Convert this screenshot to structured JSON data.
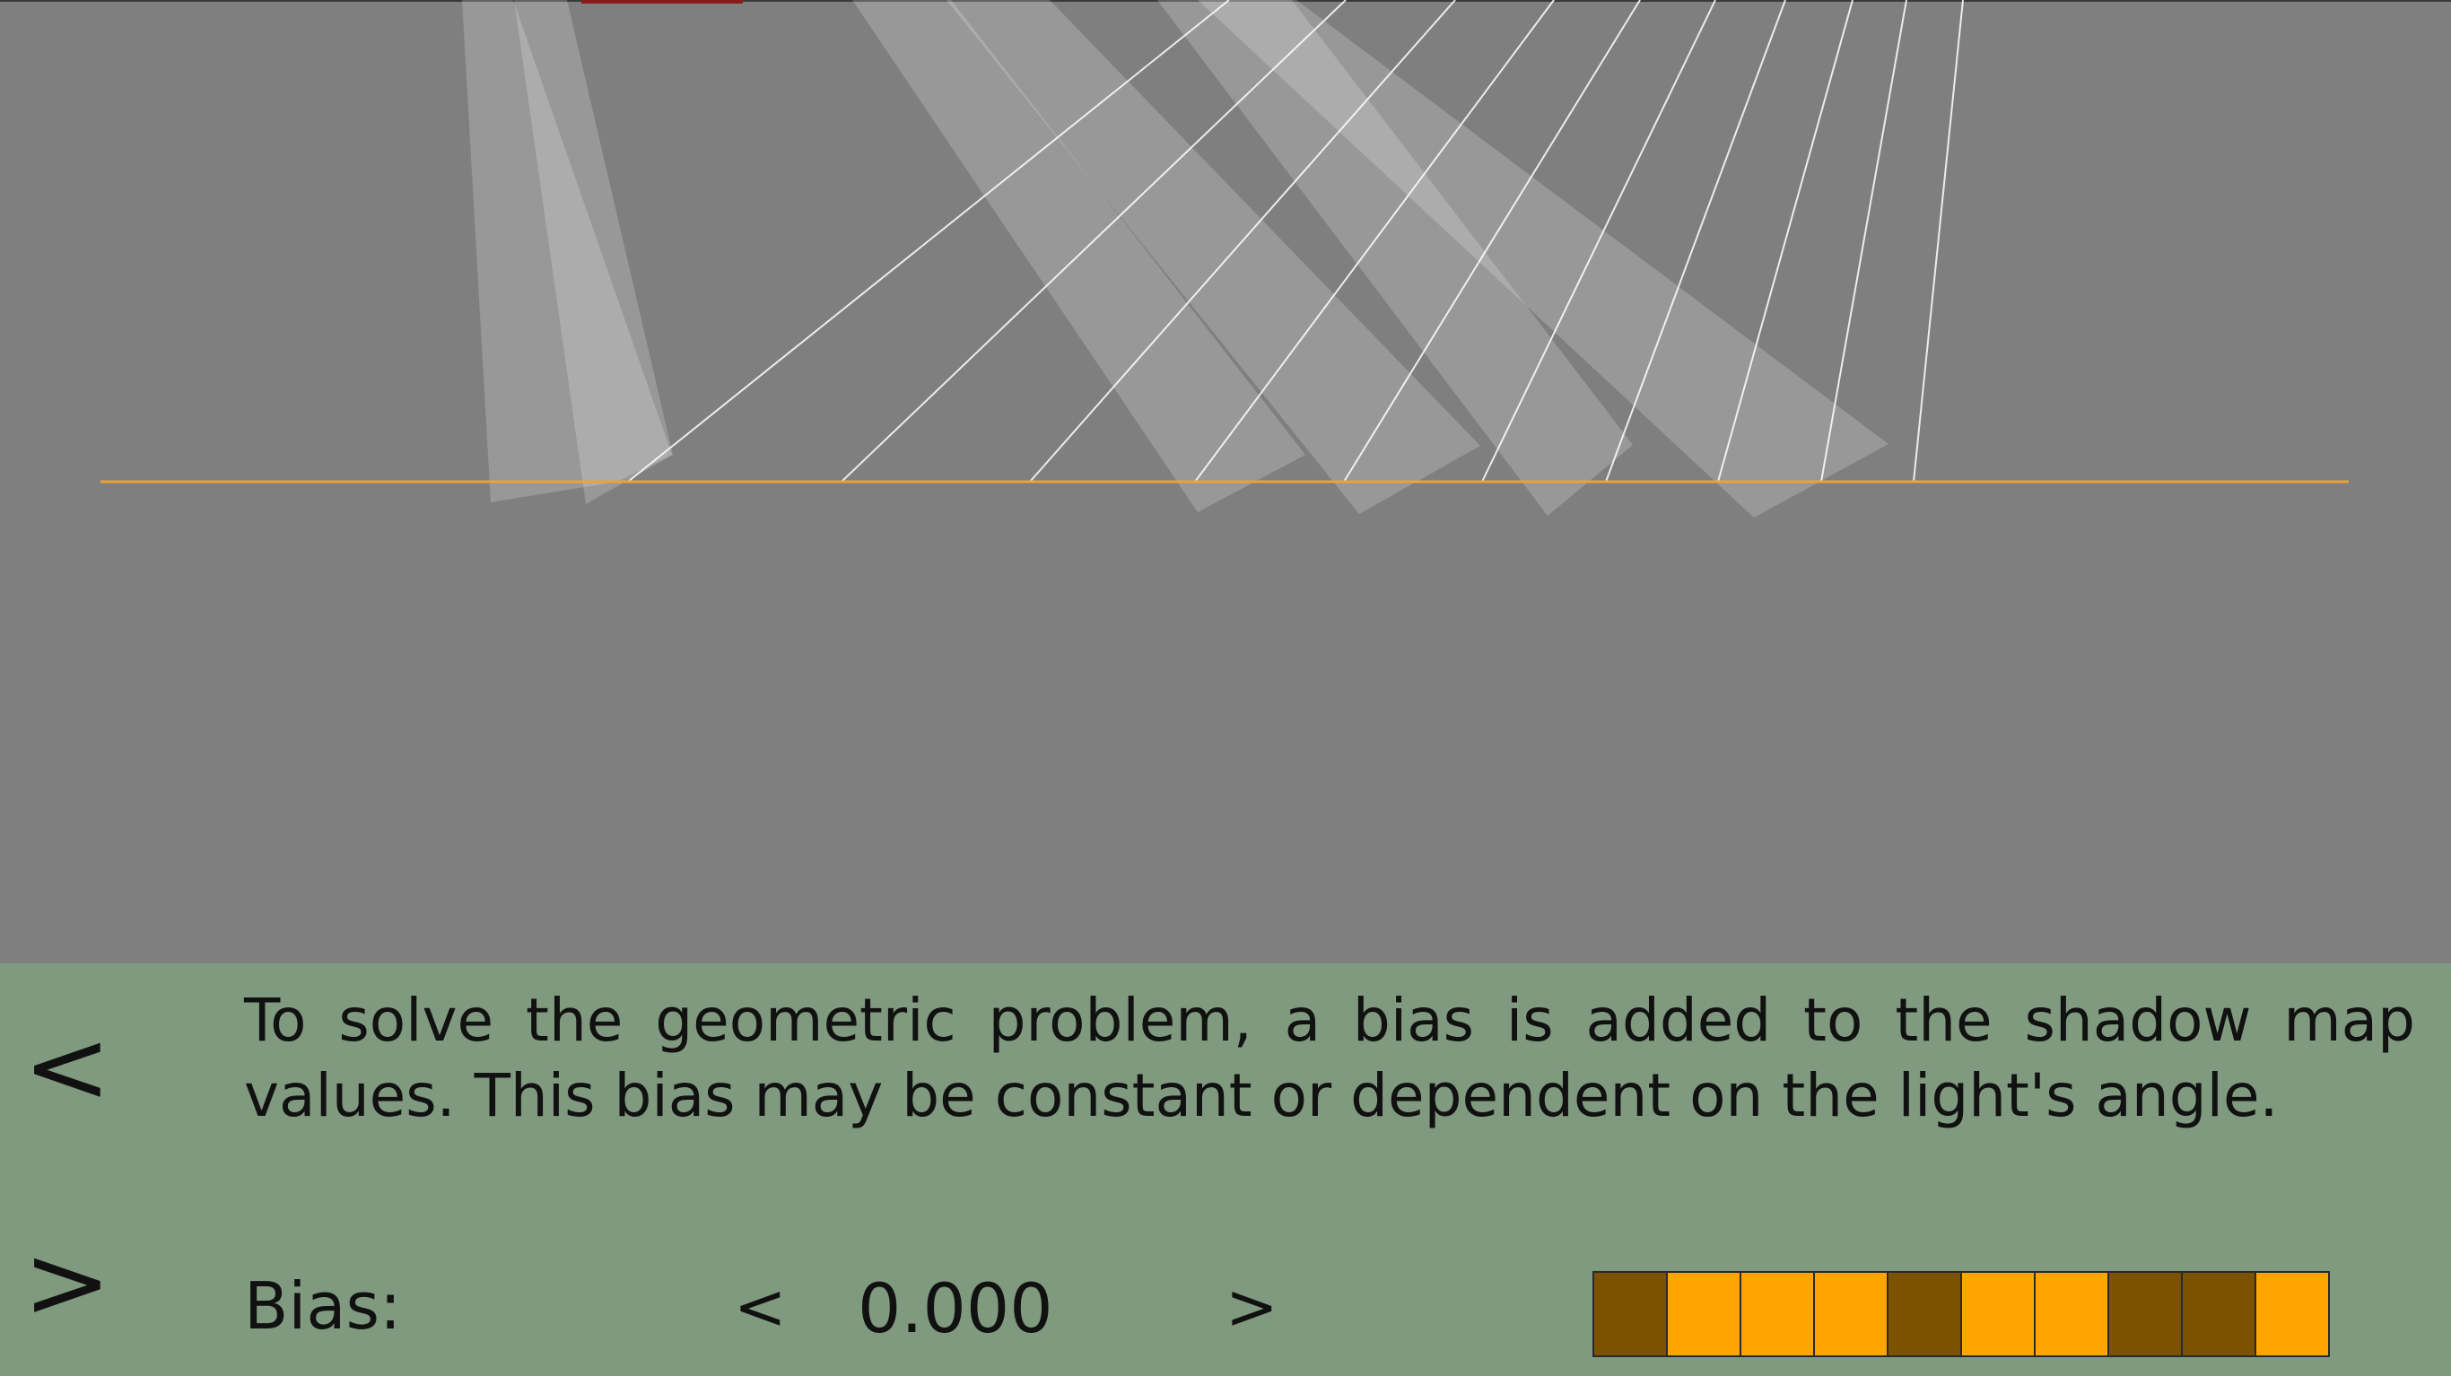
{
  "colors": {
    "scene_bg": "#7f7f7f",
    "panel_bg": "#7f9a7f",
    "surface_line": "#e8a33a",
    "light_ray": "#ffffff",
    "bit_on": "#ffa500",
    "bit_off": "#7a5200",
    "shadow_mark": "#8b1a1a"
  },
  "nav": {
    "prev_label": "<",
    "next_label": ">"
  },
  "description": "To solve the geometric problem, a bias is added to the shadow map values. This bias may be constant or dependent on the light's angle.",
  "bias": {
    "label": "Bias:",
    "decrement_label": "<",
    "value": "0.000",
    "increment_label": ">"
  },
  "bits": [
    0,
    1,
    1,
    1,
    0,
    1,
    1,
    0,
    0,
    1
  ]
}
